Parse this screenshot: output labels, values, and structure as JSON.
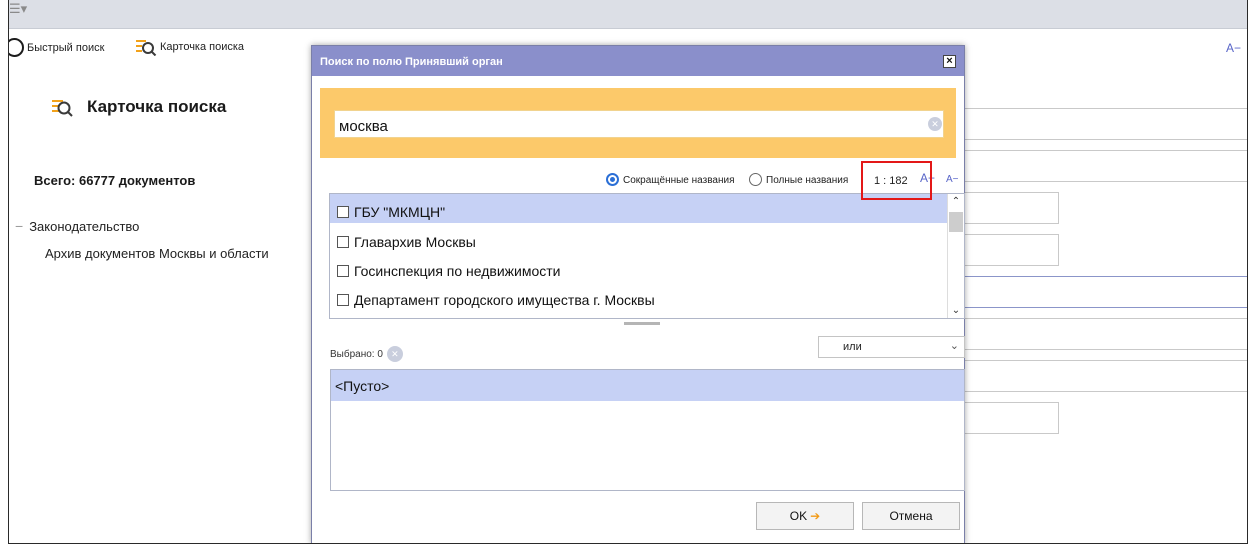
{
  "toolbar": {
    "quick_search": "Быстрый поиск",
    "search_card": "Карточка поиска",
    "font_toggle": "A−"
  },
  "main": {
    "heading": "Карточка поиска",
    "total": "Всего: 66777 документов",
    "tree": {
      "root": "Законодательство",
      "child": "Архив документов Москвы и области"
    }
  },
  "dialog": {
    "title": "Поиск по полю Принявший орган",
    "close": "×",
    "search_value": "москва",
    "options": {
      "short": "Сокращённые названия",
      "full": "Полные названия",
      "selected": "short"
    },
    "ratio": "1 : 182",
    "font_up": "A+",
    "font_down": "A−",
    "items": [
      {
        "label": "ГБУ \"МКМЦН\"",
        "selected": true
      },
      {
        "label": "Главархив Москвы",
        "selected": false
      },
      {
        "label": "Госинспекция по недвижимости",
        "selected": false
      },
      {
        "label": "Департамент городского имущества г. Москвы",
        "selected": false
      }
    ],
    "selected_label": "Выбрано: 0",
    "logic": "или",
    "empty": "<Пусто>",
    "ok": "OK",
    "cancel": "Отмена"
  },
  "colors": {
    "title_bar": "#8a8fcb",
    "search_band": "#fcc96a",
    "selection": "#c6d1f5",
    "highlight": "#e31818"
  }
}
